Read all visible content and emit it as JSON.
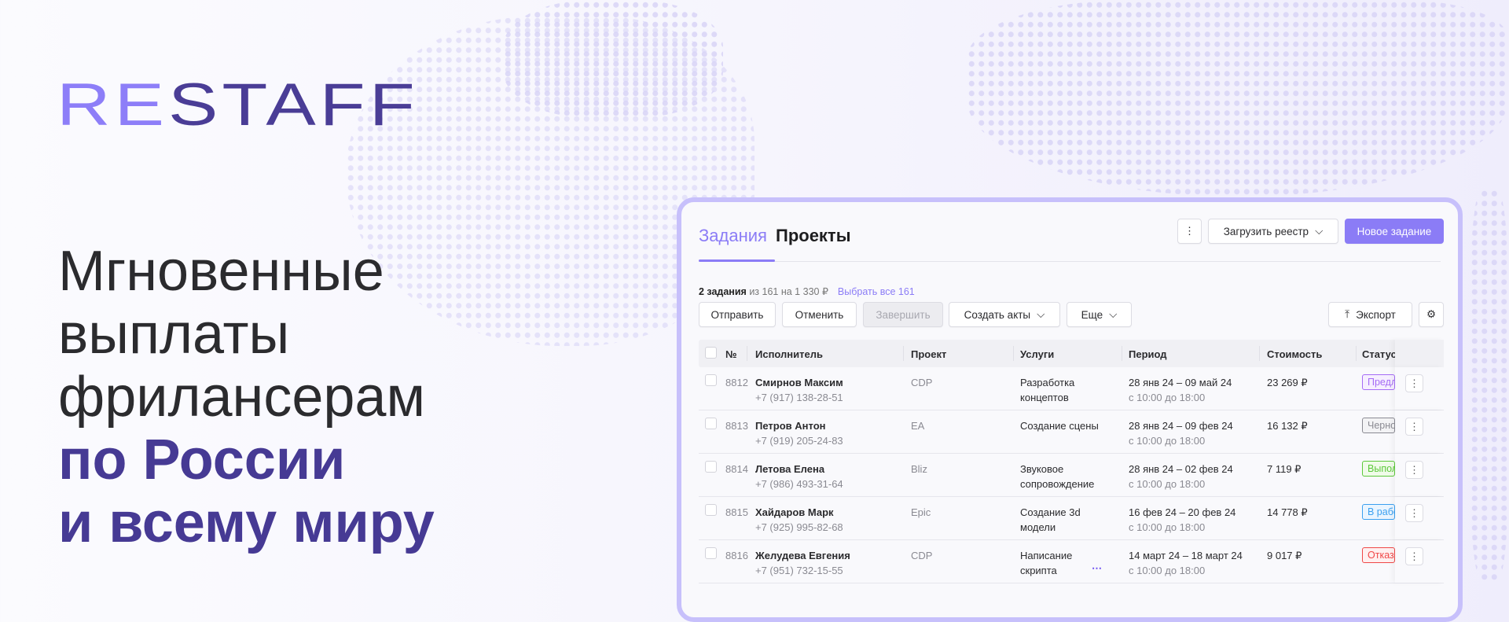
{
  "brand": {
    "logo_part1": "RE",
    "logo_part2": "STAFF"
  },
  "headline": {
    "lines": [
      "Мгновенные",
      "выплаты",
      "фрилансерам"
    ],
    "accent_lines": [
      "по России",
      "и всему миру"
    ]
  },
  "app": {
    "tabs": [
      {
        "label": "Задания",
        "active": true
      },
      {
        "label": "Проекты",
        "active": false
      }
    ],
    "header_buttons": {
      "more": "⋮",
      "upload": "Загрузить реестр",
      "new_task": "Новое задание"
    },
    "selection": {
      "count": "2 задания",
      "of": "из 161",
      "sum": "на 1 330 ₽",
      "select_all": "Выбрать все 161"
    },
    "actions": {
      "send": "Отправить",
      "cancel": "Отменить",
      "finish": "Завершить",
      "create_acts": "Создать акты",
      "more": "Еще",
      "export": "Экспорт"
    },
    "columns": [
      "№",
      "Исполнитель",
      "Проект",
      "Услуги",
      "Период",
      "Стоимость",
      "Статус"
    ],
    "rows": [
      {
        "id": "8812",
        "name": "Смирнов Максим",
        "phone": "+7 (917) 138-28-51",
        "project": "CDP",
        "service1": "Разработка",
        "service2": "концептов",
        "period": "28 янв 24 – 09 май 24",
        "time": "с 10:00 до 18:00",
        "cost": "23 269 ₽",
        "status": "Предложено"
      },
      {
        "id": "8813",
        "name": "Петров Антон",
        "phone": "+7 (919) 205-24-83",
        "project": "EA",
        "service1": "Создание сцены",
        "service2": "",
        "period": "28 янв 24 – 09 фев 24",
        "time": "с 10:00 до 18:00",
        "cost": "16 132 ₽",
        "status": "Черновик"
      },
      {
        "id": "8814",
        "name": "Летова Елена",
        "phone": "+7 (986) 493-31-64",
        "project": "Bliz",
        "service1": "Звуковое",
        "service2": "сопровождение",
        "period": "28 янв 24 – 02 фев 24",
        "time": "с 10:00 до 18:00",
        "cost": "7 119 ₽",
        "status": "Выполнено"
      },
      {
        "id": "8815",
        "name": "Хайдаров Марк",
        "phone": "+7 (925) 995-82-68",
        "project": "Epic",
        "service1": "Создание 3d",
        "service2": "модели",
        "period": "16 фев 24 – 20 фев 24",
        "time": "с 10:00 до 18:00",
        "cost": "14 778 ₽",
        "status": "В работе"
      },
      {
        "id": "8816",
        "name": "Желудева Евгения",
        "phone": "+7 (951) 732-15-55",
        "project": "CDP",
        "service1": "Написание",
        "service2": "скрипта",
        "period": "14 март 24 – 18 март 24",
        "time": "с 10:00 до 18:00",
        "cost": "9 017 ₽",
        "status": "Отказано"
      }
    ],
    "status_colors": {
      "purple": "#a56cf5",
      "grey": "#8a8a92",
      "green": "#5cc93a",
      "blue": "#3ba0f0",
      "red": "#f04848"
    },
    "accent": "#8b7cf6"
  }
}
